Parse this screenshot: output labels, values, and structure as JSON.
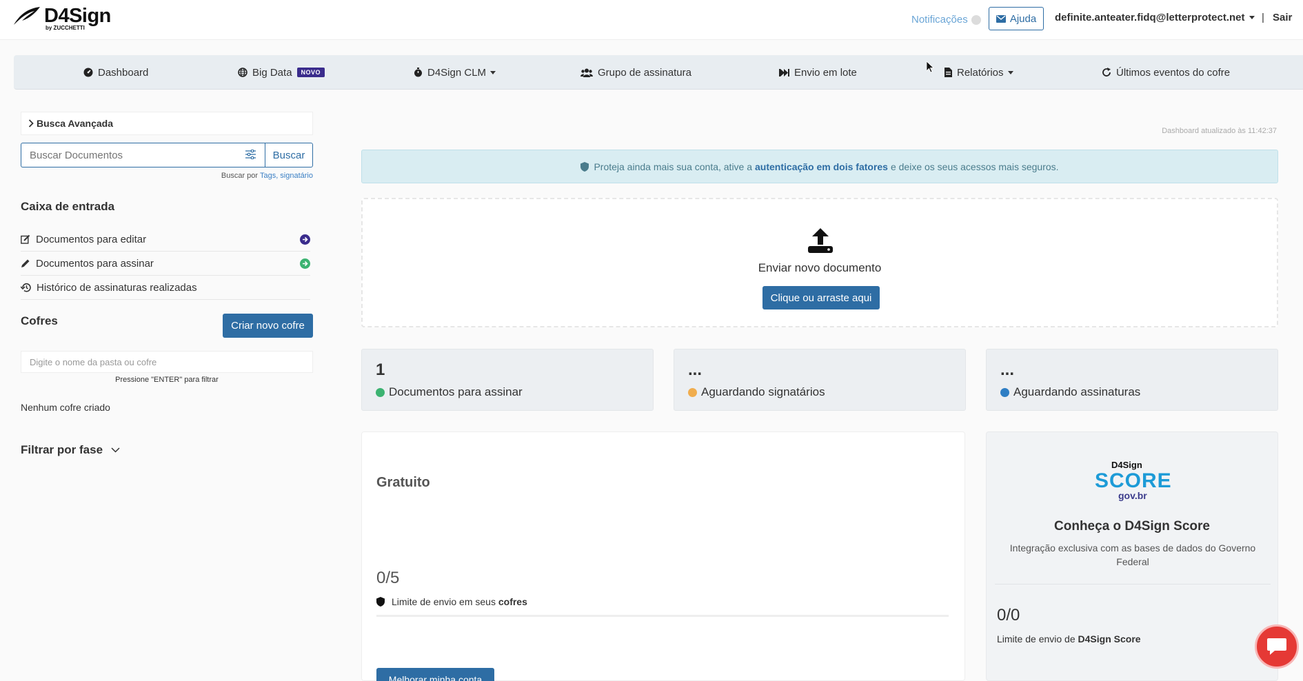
{
  "header": {
    "logo_main": "D4Sign",
    "logo_sub": "by ZUCCHETTI",
    "notifications_label": "Notificações",
    "help_label": "Ajuda",
    "user_email": "definite.anteater.fidq@letterprotect.net",
    "separator": "|",
    "logout_label": "Sair"
  },
  "nav": {
    "items": [
      {
        "label": "Dashboard",
        "icon": "dashboard-icon"
      },
      {
        "label": "Big Data",
        "icon": "globe-icon",
        "badge": "NOVO"
      },
      {
        "label": "D4Sign CLM",
        "icon": "stopwatch-icon"
      },
      {
        "label": "Grupo de assinatura",
        "icon": "users-icon"
      },
      {
        "label": "Envio em lote",
        "icon": "fast-forward-icon"
      },
      {
        "label": "Relatórios",
        "icon": "report-icon"
      },
      {
        "label": "Últimos eventos do cofre",
        "icon": "refresh-icon"
      }
    ]
  },
  "sidebar": {
    "advanced_search_label": "Busca Avançada",
    "search_placeholder": "Buscar Documentos",
    "search_button": "Buscar",
    "search_hint_prefix": "Buscar por",
    "search_hint_links": "Tags, signatário",
    "inbox_title": "Caixa de entrada",
    "inbox_items": [
      {
        "label": "Documentos para editar",
        "icon": "edit-icon"
      },
      {
        "label": "Documentos para assinar",
        "icon": "pencil-icon"
      },
      {
        "label": "Histórico de assinaturas realizadas",
        "icon": "history-icon"
      }
    ],
    "vaults_title": "Cofres",
    "create_vault_button": "Criar novo cofre",
    "folder_placeholder": "Digite o nome da pasta ou cofre",
    "enter_hint": "Pressione \"ENTER\" para filtrar",
    "no_vault": "Nenhum cofre criado",
    "phase_filter": "Filtrar por fase"
  },
  "main": {
    "updated_text": "Dashboard atualizado às 11:42:37",
    "alert_prefix": "Proteja ainda mais sua conta, ative a",
    "alert_link": "autenticação em dois fatores",
    "alert_suffix": "e deixe os seus acessos mais seguros.",
    "upload_label": "Enviar novo documento",
    "upload_button": "Clique ou arraste aqui",
    "stats": [
      {
        "value": "1",
        "label": "Documentos para assinar",
        "color": "#3cb371"
      },
      {
        "value": "...",
        "label": "Aguardando signatários",
        "color": "#f0ad4e"
      },
      {
        "value": "...",
        "label": "Aguardando assinaturas",
        "color": "#2e7ec4"
      }
    ],
    "plan": {
      "title": "Gratuito",
      "count": "0/5",
      "limit_prefix": "Limite de envio em seus",
      "limit_bold": "cofres",
      "upgrade_button": "Melhorar minha conta"
    },
    "score": {
      "brand": "D4Sign",
      "word": "SCORE",
      "sub": "gov.br",
      "title": "Conheça o D4Sign Score",
      "description": "Integração exclusiva com as bases de dados do Governo Federal",
      "count": "0/0",
      "limit_prefix": "Limite de envio de",
      "limit_bold": "D4Sign Score"
    }
  },
  "colors": {
    "primary": "#2e6da4",
    "nav_bg": "#e8edf1",
    "alert_bg": "#d9edf2",
    "badge": "#3a2c8c",
    "chat": "#e53935"
  }
}
